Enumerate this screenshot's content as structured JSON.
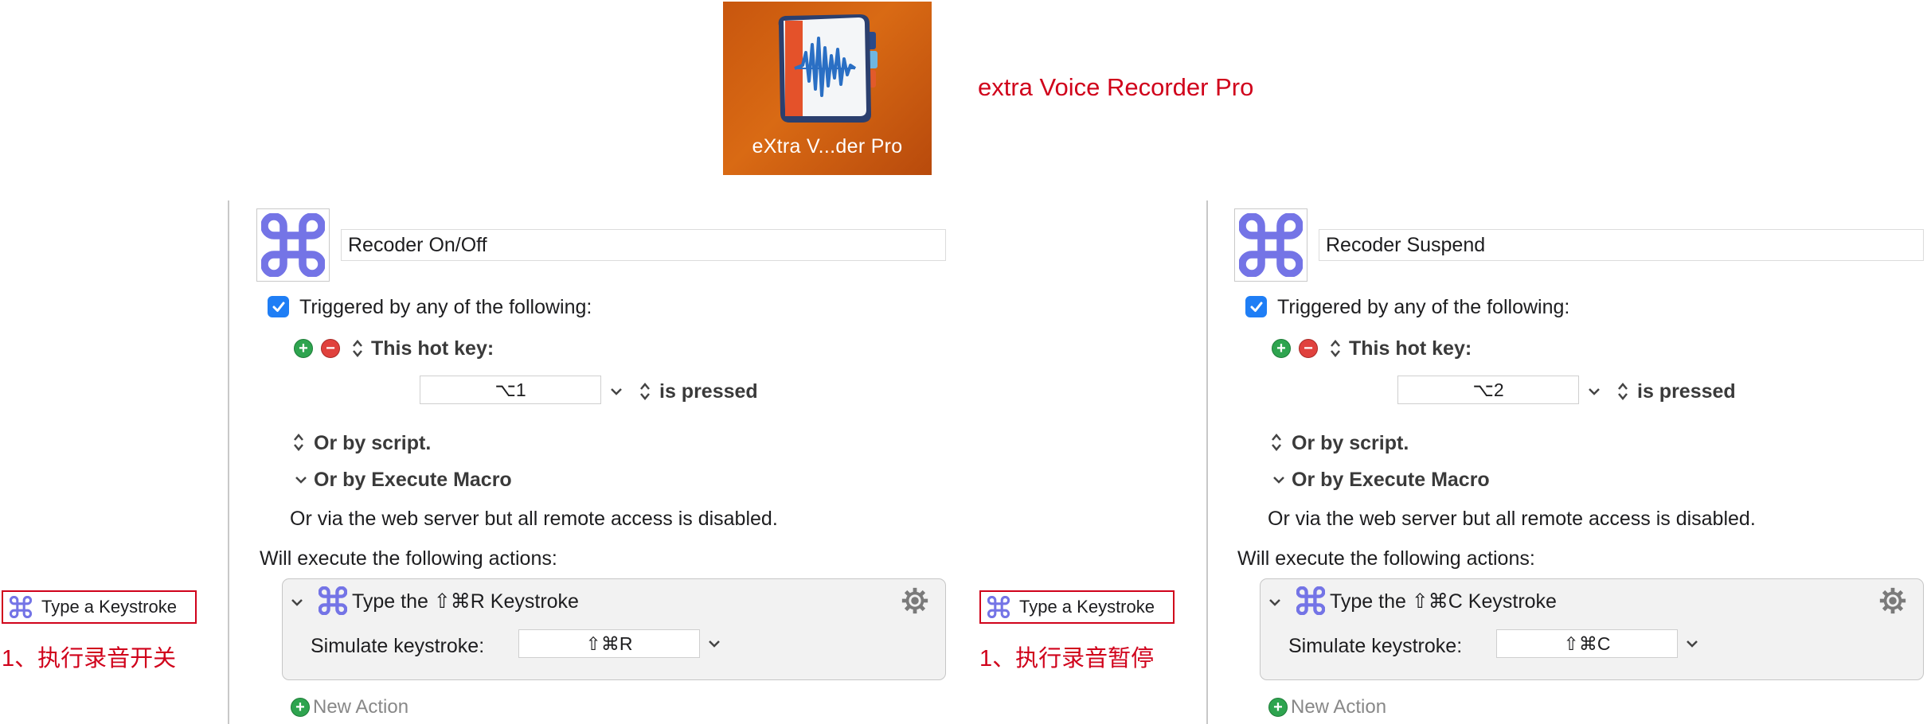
{
  "app": {
    "icon_label": "eXtra V...der Pro",
    "title": "extra Voice Recorder Pro"
  },
  "colors": {
    "accent_red": "#d0021b",
    "checkbox_blue": "#1f7ef5",
    "macro_purple": "#7474e6"
  },
  "side_labels": [
    {
      "text": "Type a Keystroke",
      "note": "1、执行录音开关"
    },
    {
      "text": "Type a Keystroke",
      "note": "1、执行录音暂停"
    }
  ],
  "macros": [
    {
      "name": "Recoder On/Off",
      "triggered_label": "Triggered by any of the following:",
      "hotkey_label": "This hot key:",
      "hotkey_value": "⌥1",
      "pressed_label": "is pressed",
      "script_label": "Or by script.",
      "execute_label": "Or by Execute Macro",
      "webserver_text": "Or via the web server but all remote access is disabled.",
      "will_execute_label": "Will execute the following actions:",
      "action_title": "Type the ⇧⌘R Keystroke",
      "simulate_label": "Simulate keystroke:",
      "simulate_value": "⇧⌘R",
      "new_action_label": "New Action"
    },
    {
      "name": "Recoder Suspend",
      "triggered_label": "Triggered by any of the following:",
      "hotkey_label": "This hot key:",
      "hotkey_value": "⌥2",
      "pressed_label": "is pressed",
      "script_label": "Or by script.",
      "execute_label": "Or by Execute Macro",
      "webserver_text": "Or via the web server but all remote access is disabled.",
      "will_execute_label": "Will execute the following actions:",
      "action_title": "Type the ⇧⌘C Keystroke",
      "simulate_label": "Simulate keystroke:",
      "simulate_value": "⇧⌘C",
      "new_action_label": "New Action"
    }
  ]
}
